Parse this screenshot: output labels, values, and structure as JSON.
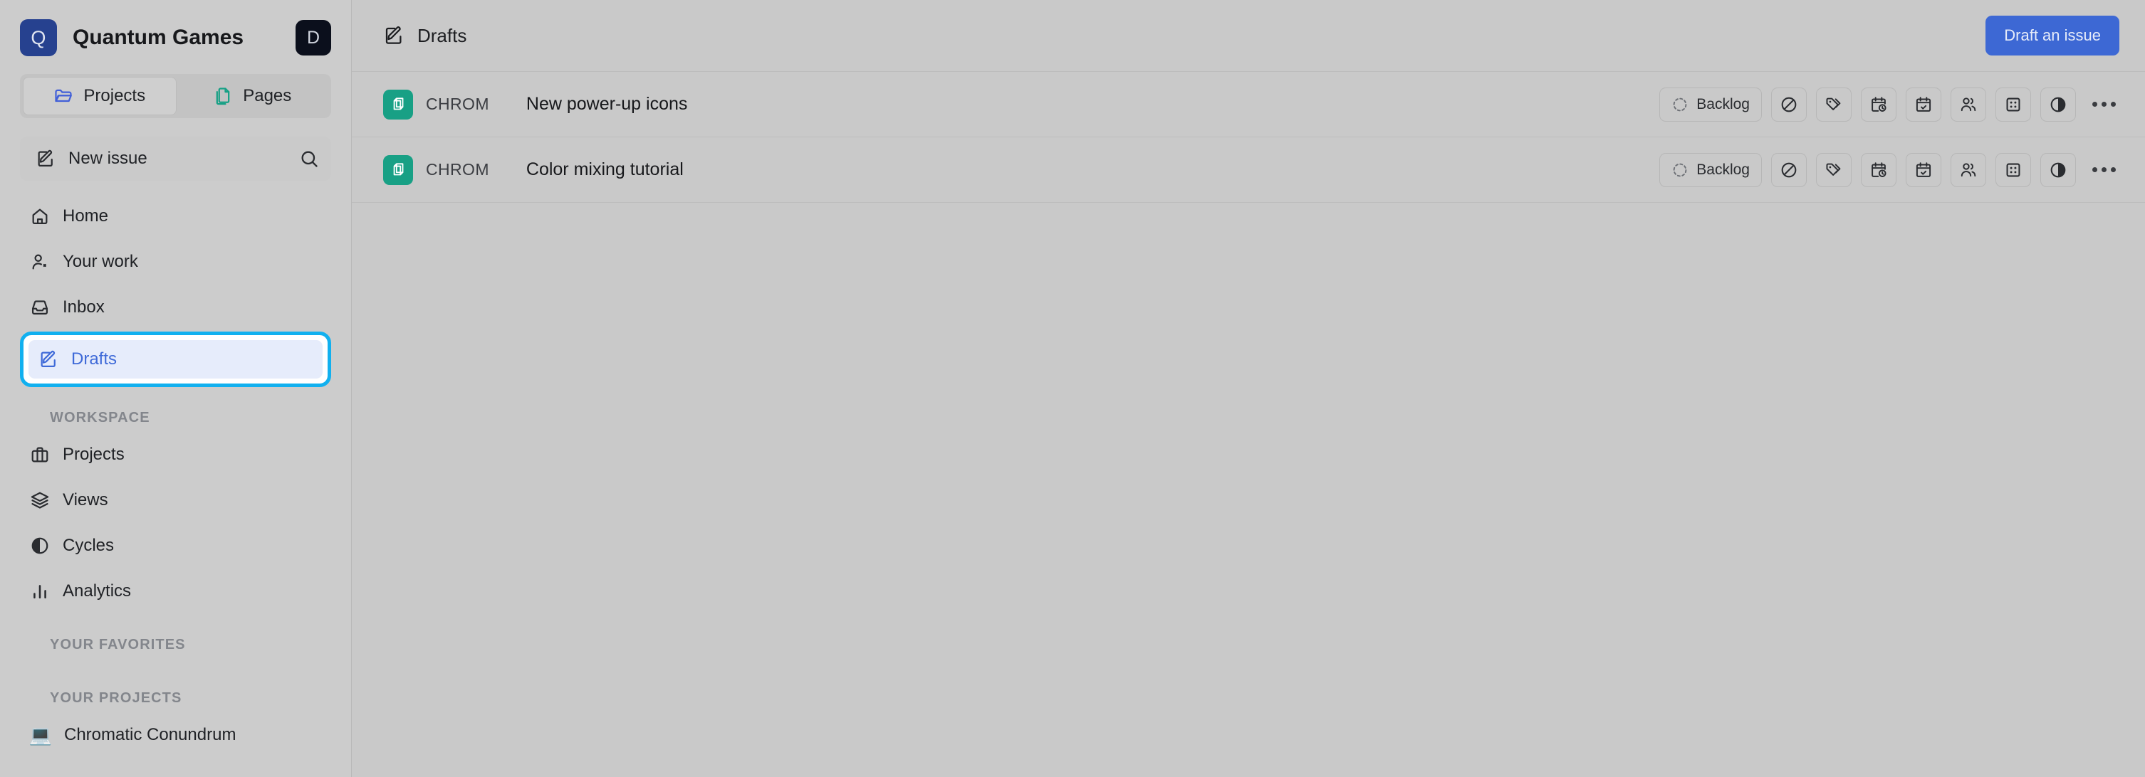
{
  "workspace": {
    "logo_letter": "Q",
    "name": "Quantum Games",
    "avatar_letter": "D",
    "tabs": [
      {
        "label": "Projects",
        "icon": "folder-open-icon",
        "active": true
      },
      {
        "label": "Pages",
        "icon": "pages-copy-icon",
        "active": false
      }
    ]
  },
  "sidebar": {
    "new_issue_label": "New issue",
    "search_icon": "search-icon",
    "primary_nav": [
      {
        "label": "Home",
        "icon": "home-icon",
        "focused": false
      },
      {
        "label": "Your work",
        "icon": "user-plus-icon",
        "focused": false
      },
      {
        "label": "Inbox",
        "icon": "inbox-icon",
        "focused": false
      },
      {
        "label": "Drafts",
        "icon": "draft-pencil-icon",
        "focused": true
      }
    ],
    "workspace_section_label": "WORKSPACE",
    "workspace_nav": [
      {
        "label": "Projects",
        "icon": "briefcase-icon"
      },
      {
        "label": "Views",
        "icon": "layers-icon"
      },
      {
        "label": "Cycles",
        "icon": "contrast-circle-icon"
      },
      {
        "label": "Analytics",
        "icon": "bar-chart-icon"
      }
    ],
    "favorites_section_label": "YOUR FAVORITES",
    "projects_section_label": "YOUR PROJECTS",
    "projects": [
      {
        "label": "Chromatic Conundrum",
        "emoji": "💻"
      }
    ]
  },
  "header": {
    "breadcrumb_icon": "draft-pencil-icon",
    "title": "Drafts",
    "primary_action": "Draft an issue"
  },
  "colors": {
    "accent_blue": "#3d68d4",
    "focus_ring": "#11b0ef",
    "project_badge": "#18a085",
    "logo_bg": "#26418f",
    "avatar_bg": "#0b0f1c"
  },
  "issues": [
    {
      "project_key": "CHROM",
      "title": "New power-up icons",
      "state": "Backlog",
      "controls": [
        {
          "name": "state-dropdown",
          "label": "Backlog",
          "icon": "dashed-circle-icon"
        },
        {
          "name": "priority-dropdown",
          "icon": "no-priority-ban-icon"
        },
        {
          "name": "labels-dropdown",
          "icon": "tags-icon"
        },
        {
          "name": "start-date-picker",
          "icon": "calendar-clock-icon"
        },
        {
          "name": "due-date-picker",
          "icon": "calendar-check-icon"
        },
        {
          "name": "assignee-dropdown",
          "icon": "users-icon"
        },
        {
          "name": "module-dropdown",
          "icon": "module-dice-icon"
        },
        {
          "name": "cycle-dropdown",
          "icon": "contrast-circle-icon"
        },
        {
          "name": "more-options-button",
          "icon": "ellipsis-icon"
        }
      ]
    },
    {
      "project_key": "CHROM",
      "title": "Color mixing tutorial",
      "state": "Backlog",
      "controls": [
        {
          "name": "state-dropdown",
          "label": "Backlog",
          "icon": "dashed-circle-icon"
        },
        {
          "name": "priority-dropdown",
          "icon": "no-priority-ban-icon"
        },
        {
          "name": "labels-dropdown",
          "icon": "tags-icon"
        },
        {
          "name": "start-date-picker",
          "icon": "calendar-clock-icon"
        },
        {
          "name": "due-date-picker",
          "icon": "calendar-check-icon"
        },
        {
          "name": "assignee-dropdown",
          "icon": "users-icon"
        },
        {
          "name": "module-dropdown",
          "icon": "module-dice-icon"
        },
        {
          "name": "cycle-dropdown",
          "icon": "contrast-circle-icon"
        },
        {
          "name": "more-options-button",
          "icon": "ellipsis-icon"
        }
      ]
    }
  ]
}
